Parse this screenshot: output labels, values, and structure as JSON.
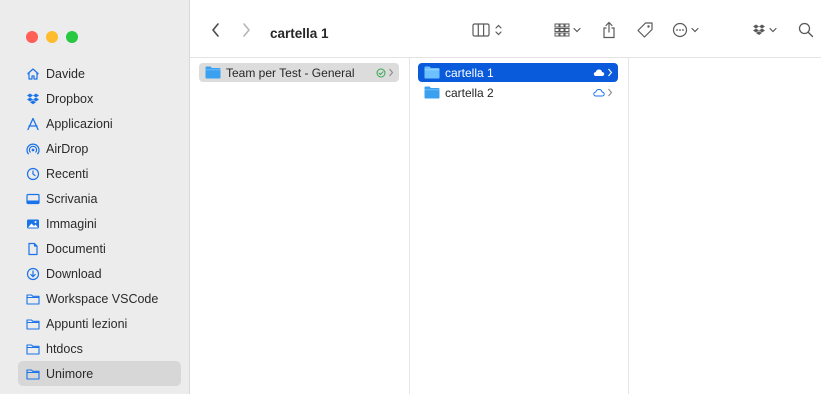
{
  "window": {
    "title": "cartella 1"
  },
  "sidebar": {
    "items": [
      {
        "label": "Davide",
        "icon": "home-icon"
      },
      {
        "label": "Dropbox",
        "icon": "dropbox-icon"
      },
      {
        "label": "Applicazioni",
        "icon": "applications-icon"
      },
      {
        "label": "AirDrop",
        "icon": "airdrop-icon"
      },
      {
        "label": "Recenti",
        "icon": "clock-icon"
      },
      {
        "label": "Scrivania",
        "icon": "desktop-icon"
      },
      {
        "label": "Immagini",
        "icon": "photo-icon"
      },
      {
        "label": "Documenti",
        "icon": "document-icon"
      },
      {
        "label": "Download",
        "icon": "download-icon"
      },
      {
        "label": "Workspace VSCode",
        "icon": "folder-icon"
      },
      {
        "label": "Appunti lezioni",
        "icon": "folder-icon"
      },
      {
        "label": "htdocs",
        "icon": "folder-icon"
      },
      {
        "label": "Unimore",
        "icon": "folder-icon"
      }
    ],
    "selected": "Unimore"
  },
  "toolbar": {
    "back": "‹",
    "forward": "›"
  },
  "columns": [
    {
      "items": [
        {
          "label": "Team per Test - General",
          "status": "synced-check",
          "state": "path"
        }
      ]
    },
    {
      "items": [
        {
          "label": "cartella 1",
          "status": "cloud-filled",
          "state": "selected"
        },
        {
          "label": "cartella 2",
          "status": "cloud-outline",
          "state": "normal"
        }
      ]
    }
  ],
  "colors": {
    "accent": "#0a5bdc",
    "folder": "#3aa0f0",
    "sidebar_icon": "#1a73e8"
  }
}
